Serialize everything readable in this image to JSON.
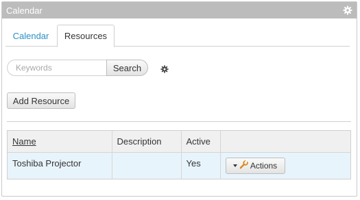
{
  "panel": {
    "title": "Calendar",
    "settings_icon": "gear-icon"
  },
  "tabs": [
    {
      "label": "Calendar",
      "active": false
    },
    {
      "label": "Resources",
      "active": true
    }
  ],
  "search": {
    "placeholder": "Keywords",
    "value": "",
    "button_label": "Search",
    "settings_icon": "gear-icon"
  },
  "toolbar": {
    "add_label": "Add Resource"
  },
  "table": {
    "headers": [
      "Name",
      "Description",
      "Active",
      ""
    ],
    "rows": [
      {
        "name": "Toshiba Projector",
        "description": "",
        "active": "Yes",
        "actions_label": "Actions",
        "actions_icon": "wrench-icon"
      }
    ]
  },
  "colors": {
    "header_bg": "#bcbcbc",
    "tab_link": "#2a8fc6",
    "row_bg": "#e8f4fb",
    "header_row_bg": "#f0f0f0"
  }
}
